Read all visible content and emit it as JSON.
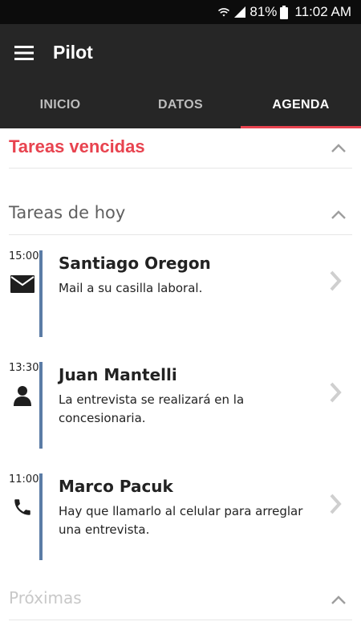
{
  "status_bar": {
    "battery": "81%",
    "time": "11:02 AM",
    "icons": [
      "wifi-icon",
      "signal-icon",
      "battery-icon"
    ]
  },
  "app_bar": {
    "title": "Pilot",
    "menu_icon": "hamburger-menu-icon"
  },
  "tabs": [
    {
      "label": "INICIO",
      "active": false
    },
    {
      "label": "DATOS",
      "active": false
    },
    {
      "label": "AGENDA",
      "active": true
    }
  ],
  "sections": {
    "overdue": {
      "title": "Tareas vencidas",
      "state": "expanded"
    },
    "today": {
      "title": "Tareas de hoy",
      "state": "expanded"
    },
    "upcoming": {
      "title": "Próximas",
      "state": "expanded"
    }
  },
  "tasks": [
    {
      "time": "15:00",
      "type_icon": "mail-icon",
      "name": "Santiago Oregon",
      "description": "Mail a su casilla laboral."
    },
    {
      "time": "13:30",
      "type_icon": "person-icon",
      "name": "Juan Mantelli",
      "description": "La entrevista se realizará en la concesionaria."
    },
    {
      "time": "11:00",
      "type_icon": "phone-icon",
      "name": "Marco Pacuk",
      "description": "Hay que llamarlo al celular para arreglar una entrevista."
    }
  ],
  "colors": {
    "accent": "#e8434f",
    "app_bar": "#262626",
    "timeline": "#5b7ca6"
  }
}
